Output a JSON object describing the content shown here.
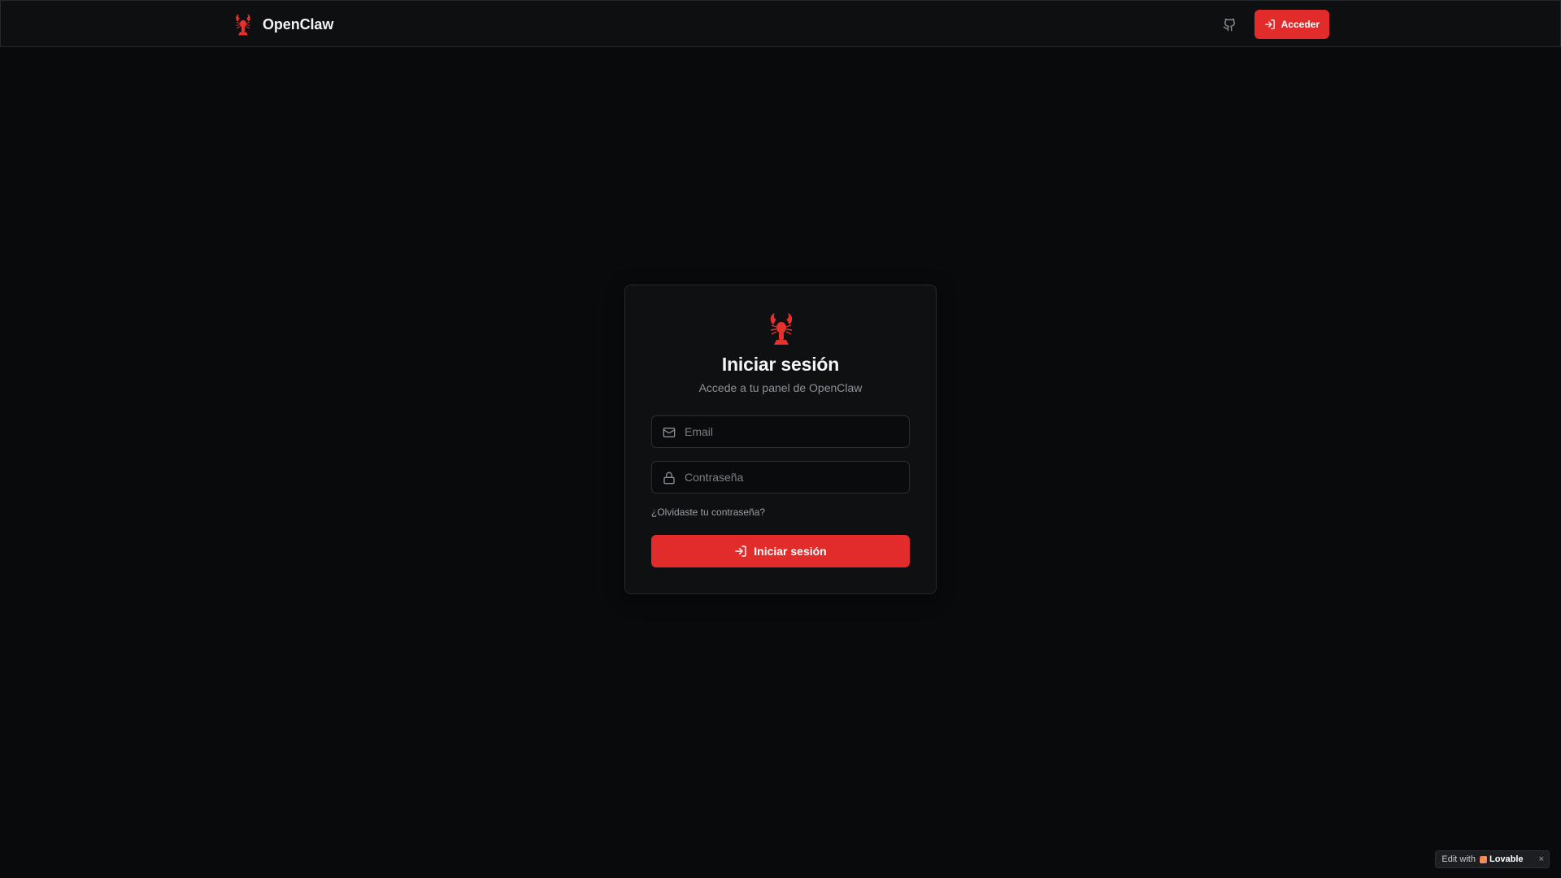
{
  "navbar": {
    "brand_name": "OpenClaw",
    "github_icon": "github-icon",
    "login_button_label": "Acceder",
    "login_icon": "log-in-icon"
  },
  "login_card": {
    "logo_icon": "lobster-icon",
    "title": "Iniciar sesión",
    "subtitle": "Accede a tu panel de OpenClaw",
    "email_field": {
      "icon": "mail-icon",
      "placeholder": "Email",
      "value": ""
    },
    "password_field": {
      "icon": "lock-icon",
      "placeholder": "Contraseña",
      "value": ""
    },
    "forgot_link": "¿Olvidaste tu contraseña?",
    "submit_label": "Iniciar sesión",
    "submit_icon": "log-in-icon"
  },
  "lovable_badge": {
    "prefix": "Edit with",
    "brand": "Lovable",
    "close_glyph": "×"
  },
  "colors": {
    "background": "#090a0b",
    "accent": "#e22b2b",
    "card": "#0e1012",
    "muted_text": "#8e939a"
  }
}
